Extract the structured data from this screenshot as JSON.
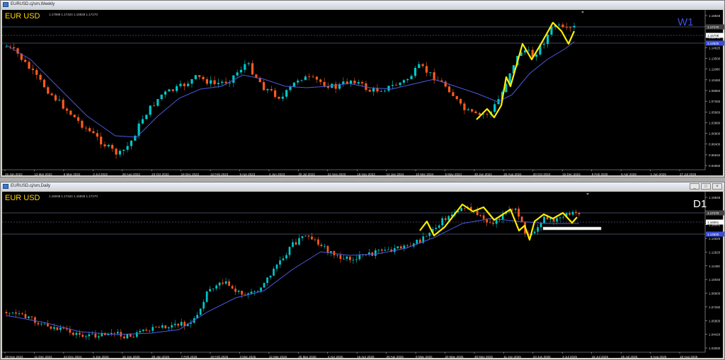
{
  "windows": [
    {
      "title": "EURUSD.cj/sm,Weekly",
      "symbol_label": "EUR USD",
      "timeframe_label": "W1",
      "ohlc_header": "1.17089 1.17424 1.15828 1.17170",
      "price_axis": [
        "1.18848",
        "1.17170",
        "1.15708",
        "1.14625",
        "1.13500",
        "1.11960",
        "1.10460",
        "1.08860",
        "1.07260",
        "1.05660",
        "1.03880",
        "1.00900",
        "0.98400",
        "0.96940",
        "0.94960"
      ],
      "price_tags": [
        "1.17170",
        "1.15708",
        "1.14625"
      ],
      "time_axis": [
        "16 Jan 2022",
        "13 Mar 2022",
        "8 May 2022",
        "3 Jul 2022",
        "28 Aug 2022",
        "23 Oct 2022",
        "18 Dec 2022",
        "12 Feb 2023",
        "9 Apr 2023",
        "4 Jun 2023",
        "30 Jul 2023",
        "24 Sep 2023",
        "19 Nov 2023",
        "14 Jan 2024",
        "10 Mar 2024",
        "5 May 2024",
        "30 Jun 2024",
        "25 Aug 2024",
        "20 Oct 2024",
        "15 Dec 2024",
        "9 Feb 2025",
        "6 Apr 2025",
        "1 Jun 2025",
        "27 Jul 2025"
      ]
    },
    {
      "title": "EURUSD.cj/sm,Daily",
      "symbol_label": "EUR USD",
      "timeframe_label": "D1",
      "ohlc_header": "1.16048 1.17424 1.15828 1.17170",
      "price_axis": [
        "1.18848",
        "1.17170",
        "1.16001",
        "1.14625",
        "1.12920",
        "1.11460",
        "1.10040",
        "1.08600",
        "1.07260",
        "1.05800",
        "1.04420",
        "1.03000"
      ],
      "price_tags": [
        "1.17170",
        "1.16001",
        "1.14625"
      ],
      "time_axis": [
        "29 Nov 2024",
        "11 Dec 2024",
        "24 Dec 2024",
        "6 Jan 2025",
        "16 Jan 2025",
        "28 Jan 2025",
        "7 Feb 2025",
        "19 Feb 2025",
        "3 Mar 2025",
        "12 Mar 2025",
        "25 Mar 2025",
        "4 Apr 2025",
        "16 Apr 2025",
        "28 Apr 2025",
        "8 May 2025",
        "20 May 2025",
        "30 May 2025",
        "11 Jun 2025",
        "23 Jun 2025",
        "3 Jul 2025",
        "15 Jul 2025",
        "25 Jul 2025",
        "6 Aug 2025",
        "18 Aug 2025"
      ]
    }
  ],
  "colors": {
    "bull": "#00c8c8",
    "bear": "#ff5a1e",
    "ma": "#4b5adc",
    "zigzag": "#ffee00",
    "symbol": "#ffd700",
    "timeframe_w1": "#3c50dc",
    "timeframe_d1": "#ffffff",
    "hline": "#7f8fb0"
  },
  "window_buttons": [
    "_",
    "□",
    "×"
  ]
}
